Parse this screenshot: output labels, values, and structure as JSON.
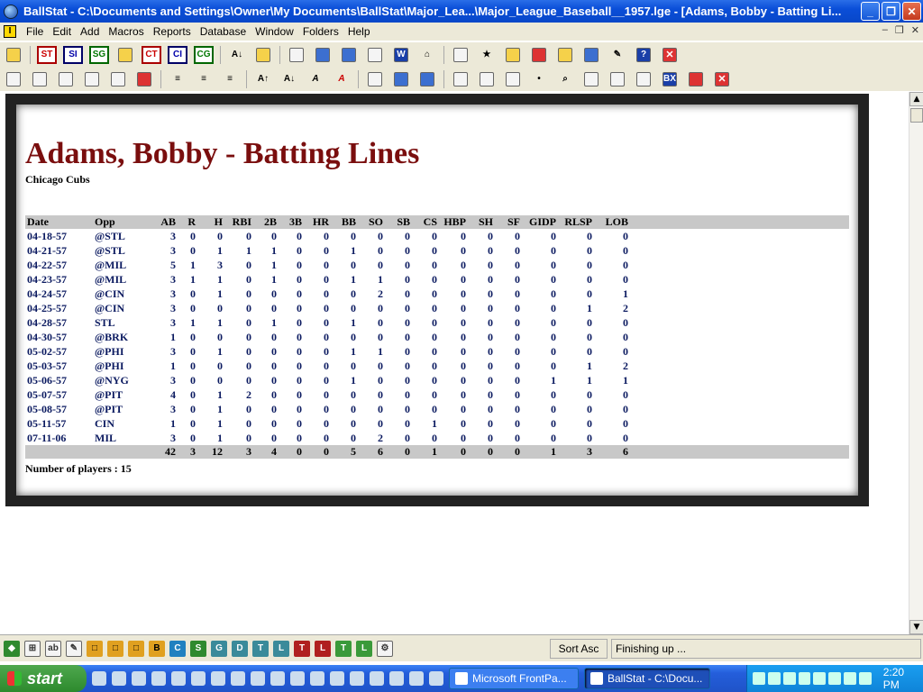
{
  "window": {
    "title": "BallStat  -  C:\\Documents and Settings\\Owner\\My Documents\\BallStat\\Major_Lea...\\Major_League_Baseball__1957.lge  - [Adams, Bobby - Batting Li..."
  },
  "menu": [
    "File",
    "Edit",
    "Add",
    "Macros",
    "Reports",
    "Database",
    "Window",
    "Folders",
    "Help"
  ],
  "toolbar1": {
    "labels": [
      "ST",
      "SI",
      "SG",
      "CT",
      "CI",
      "CG"
    ]
  },
  "report": {
    "title": "Adams, Bobby - Batting Lines",
    "team": "Chicago Cubs",
    "columns": [
      "Date",
      "Opp",
      "AB",
      "R",
      "H",
      "RBI",
      "2B",
      "3B",
      "HR",
      "BB",
      "SO",
      "SB",
      "CS",
      "HBP",
      "SH",
      "SF",
      "GIDP",
      "RLSP",
      "LOB"
    ],
    "rows": [
      [
        "04-18-57",
        "@STL",
        "3",
        "0",
        "0",
        "0",
        "0",
        "0",
        "0",
        "0",
        "0",
        "0",
        "0",
        "0",
        "0",
        "0",
        "0",
        "0",
        "0"
      ],
      [
        "04-21-57",
        "@STL",
        "3",
        "0",
        "1",
        "1",
        "1",
        "0",
        "0",
        "1",
        "0",
        "0",
        "0",
        "0",
        "0",
        "0",
        "0",
        "0",
        "0"
      ],
      [
        "04-22-57",
        "@MIL",
        "5",
        "1",
        "3",
        "0",
        "1",
        "0",
        "0",
        "0",
        "0",
        "0",
        "0",
        "0",
        "0",
        "0",
        "0",
        "0",
        "0"
      ],
      [
        "04-23-57",
        "@MIL",
        "3",
        "1",
        "1",
        "0",
        "1",
        "0",
        "0",
        "1",
        "1",
        "0",
        "0",
        "0",
        "0",
        "0",
        "0",
        "0",
        "0"
      ],
      [
        "04-24-57",
        "@CIN",
        "3",
        "0",
        "1",
        "0",
        "0",
        "0",
        "0",
        "0",
        "2",
        "0",
        "0",
        "0",
        "0",
        "0",
        "0",
        "0",
        "1"
      ],
      [
        "04-25-57",
        "@CIN",
        "3",
        "0",
        "0",
        "0",
        "0",
        "0",
        "0",
        "0",
        "0",
        "0",
        "0",
        "0",
        "0",
        "0",
        "0",
        "1",
        "2"
      ],
      [
        "04-28-57",
        "STL",
        "3",
        "1",
        "1",
        "0",
        "1",
        "0",
        "0",
        "1",
        "0",
        "0",
        "0",
        "0",
        "0",
        "0",
        "0",
        "0",
        "0"
      ],
      [
        "04-30-57",
        "@BRK",
        "1",
        "0",
        "0",
        "0",
        "0",
        "0",
        "0",
        "0",
        "0",
        "0",
        "0",
        "0",
        "0",
        "0",
        "0",
        "0",
        "0"
      ],
      [
        "05-02-57",
        "@PHI",
        "3",
        "0",
        "1",
        "0",
        "0",
        "0",
        "0",
        "1",
        "1",
        "0",
        "0",
        "0",
        "0",
        "0",
        "0",
        "0",
        "0"
      ],
      [
        "05-03-57",
        "@PHI",
        "1",
        "0",
        "0",
        "0",
        "0",
        "0",
        "0",
        "0",
        "0",
        "0",
        "0",
        "0",
        "0",
        "0",
        "0",
        "1",
        "2"
      ],
      [
        "05-06-57",
        "@NYG",
        "3",
        "0",
        "0",
        "0",
        "0",
        "0",
        "0",
        "1",
        "0",
        "0",
        "0",
        "0",
        "0",
        "0",
        "1",
        "1",
        "1"
      ],
      [
        "05-07-57",
        "@PIT",
        "4",
        "0",
        "1",
        "2",
        "0",
        "0",
        "0",
        "0",
        "0",
        "0",
        "0",
        "0",
        "0",
        "0",
        "0",
        "0",
        "0"
      ],
      [
        "05-08-57",
        "@PIT",
        "3",
        "0",
        "1",
        "0",
        "0",
        "0",
        "0",
        "0",
        "0",
        "0",
        "0",
        "0",
        "0",
        "0",
        "0",
        "0",
        "0"
      ],
      [
        "05-11-57",
        "CIN",
        "1",
        "0",
        "1",
        "0",
        "0",
        "0",
        "0",
        "0",
        "0",
        "0",
        "1",
        "0",
        "0",
        "0",
        "0",
        "0",
        "0"
      ],
      [
        "07-11-06",
        "MIL",
        "3",
        "0",
        "1",
        "0",
        "0",
        "0",
        "0",
        "0",
        "2",
        "0",
        "0",
        "0",
        "0",
        "0",
        "0",
        "0",
        "0"
      ]
    ],
    "totals": [
      "",
      "",
      "42",
      "3",
      "12",
      "3",
      "4",
      "0",
      "0",
      "5",
      "6",
      "0",
      "1",
      "0",
      "0",
      "0",
      "1",
      "3",
      "6"
    ],
    "player_count": "Number of players : 15"
  },
  "bottombar": {
    "letters": [
      "B",
      "C",
      "S",
      "G",
      "D",
      "T",
      "L",
      "T",
      "L",
      "T",
      "L"
    ]
  },
  "status": {
    "left": "Sort Asc",
    "right": "Finishing up ..."
  },
  "taskbar": {
    "start": "start",
    "tasks": [
      "Microsoft FrontPa...",
      "BallStat - C:\\Docu..."
    ],
    "clock": "2:20 PM"
  }
}
